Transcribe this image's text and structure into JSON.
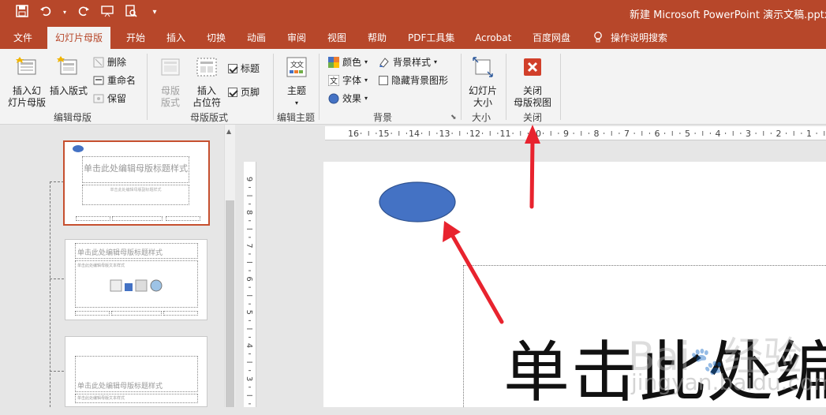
{
  "doc_title": "新建 Microsoft PowerPoint 演示文稿.pptx  -",
  "qat": [
    "save-icon",
    "undo-icon",
    "redo-icon",
    "slideshow-icon",
    "preview-icon",
    "more-icon"
  ],
  "tabs": [
    "文件",
    "幻灯片母版",
    "开始",
    "插入",
    "切换",
    "动画",
    "审阅",
    "视图",
    "帮助",
    "PDF工具集",
    "Acrobat",
    "百度网盘",
    "操作说明搜索"
  ],
  "ribbon": {
    "edit_master": {
      "insert_slide_master": "插入幻\n灯片母版",
      "insert_layout": "插入版式",
      "delete": "删除",
      "rename": "重命名",
      "preserve": "保留",
      "label": "编辑母版"
    },
    "master_layout": {
      "master_layout_btn": "母版\n版式",
      "insert_placeholder": "插入\n占位符",
      "title_chk": "标题",
      "footer_chk": "页脚",
      "label": "母版版式"
    },
    "edit_theme": {
      "theme": "主题",
      "label": "编辑主题"
    },
    "background": {
      "colors": "颜色",
      "fonts": "字体",
      "effects": "效果",
      "bg_styles": "背景样式",
      "hide_bg": "隐藏背景图形",
      "label": "背景"
    },
    "size": {
      "slide_size": "幻灯片\n大小",
      "label": "大小"
    },
    "close": {
      "close_master": "关闭\n母版视图",
      "label": "关闭"
    }
  },
  "ruler_h": [
    "16",
    "15",
    "14",
    "13",
    "12",
    "11",
    "10",
    "9",
    "8",
    "7",
    "6",
    "5",
    "4",
    "3",
    "2",
    "1"
  ],
  "ruler_v": [
    "9",
    "8",
    "7",
    "6",
    "5",
    "4",
    "3"
  ],
  "thumbs": {
    "t1_title": "单击此处编辑母版标题样式",
    "t1_sub": "单击此处编辑母版副标题样式",
    "t2_title": "单击此处编辑母版标题样式",
    "t2_body": "单击此处编辑母版文本样式",
    "t3_title": "单击此处编辑母版标题样式",
    "t3_sub": "单击此处编辑母版文本样式"
  },
  "slide": {
    "title_text": "单击此处编"
  },
  "colors": {
    "accent": "#b7472a",
    "ellipse": "#4472c4",
    "arrow": "#e8232e"
  }
}
